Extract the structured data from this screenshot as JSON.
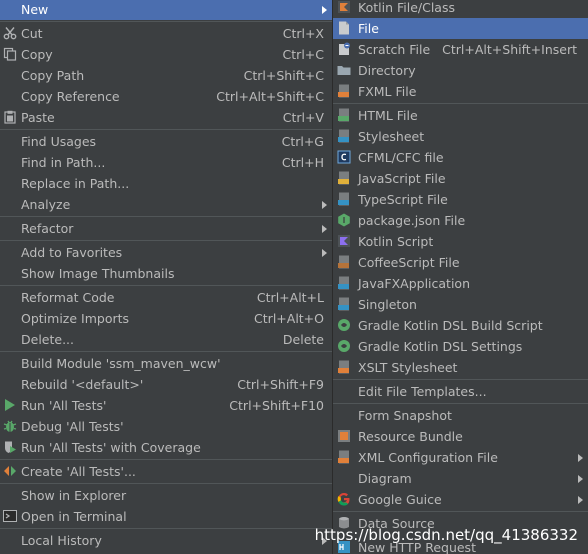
{
  "left_menu": {
    "new": {
      "label": "New"
    },
    "cut": {
      "label": "Cut",
      "shortcut": "Ctrl+X"
    },
    "copy": {
      "label": "Copy",
      "shortcut": "Ctrl+C"
    },
    "copy_path": {
      "label": "Copy Path",
      "shortcut": "Ctrl+Shift+C"
    },
    "copy_reference": {
      "label": "Copy Reference",
      "shortcut": "Ctrl+Alt+Shift+C"
    },
    "paste": {
      "label": "Paste",
      "shortcut": "Ctrl+V"
    },
    "find_usages": {
      "label": "Find Usages",
      "shortcut": "Ctrl+G"
    },
    "find_in_path": {
      "label": "Find in Path...",
      "shortcut": "Ctrl+H"
    },
    "replace_in_path": {
      "label": "Replace in Path..."
    },
    "analyze": {
      "label": "Analyze"
    },
    "refactor": {
      "label": "Refactor"
    },
    "add_to_favorites": {
      "label": "Add to Favorites"
    },
    "show_image_thumbnails": {
      "label": "Show Image Thumbnails"
    },
    "reformat_code": {
      "label": "Reformat Code",
      "shortcut": "Ctrl+Alt+L"
    },
    "optimize_imports": {
      "label": "Optimize Imports",
      "shortcut": "Ctrl+Alt+O"
    },
    "delete": {
      "label": "Delete...",
      "shortcut": "Delete"
    },
    "build_module": {
      "label": "Build Module 'ssm_maven_wcw'"
    },
    "rebuild": {
      "label": "Rebuild '<default>'",
      "shortcut": "Ctrl+Shift+F9"
    },
    "run_all_tests": {
      "label": "Run 'All Tests'",
      "shortcut": "Ctrl+Shift+F10"
    },
    "debug_all_tests": {
      "label": "Debug 'All Tests'"
    },
    "run_with_coverage": {
      "label": "Run 'All Tests' with Coverage"
    },
    "create_all_tests": {
      "label": "Create 'All Tests'..."
    },
    "show_in_explorer": {
      "label": "Show in Explorer"
    },
    "open_in_terminal": {
      "label": "Open in Terminal"
    },
    "local_history": {
      "label": "Local History"
    }
  },
  "right_menu": {
    "kotlin_file_class": {
      "label": "Kotlin File/Class"
    },
    "file": {
      "label": "File"
    },
    "scratch_file": {
      "label": "Scratch File",
      "shortcut": "Ctrl+Alt+Shift+Insert"
    },
    "directory": {
      "label": "Directory"
    },
    "fxml_file": {
      "label": "FXML File"
    },
    "html_file": {
      "label": "HTML File"
    },
    "stylesheet": {
      "label": "Stylesheet"
    },
    "cfml_cfc_file": {
      "label": "CFML/CFC file"
    },
    "javascript_file": {
      "label": "JavaScript File"
    },
    "typescript_file": {
      "label": "TypeScript File"
    },
    "package_json_file": {
      "label": "package.json File"
    },
    "kotlin_script": {
      "label": "Kotlin Script"
    },
    "coffeescript_file": {
      "label": "CoffeeScript File"
    },
    "javafx_application": {
      "label": "JavaFXApplication"
    },
    "singleton": {
      "label": "Singleton"
    },
    "gradle_kotlin_dsl_build_script": {
      "label": "Gradle Kotlin DSL Build Script"
    },
    "gradle_kotlin_dsl_settings": {
      "label": "Gradle Kotlin DSL Settings"
    },
    "xslt_stylesheet": {
      "label": "XSLT Stylesheet"
    },
    "edit_file_templates": {
      "label": "Edit File Templates..."
    },
    "form_snapshot": {
      "label": "Form Snapshot"
    },
    "resource_bundle": {
      "label": "Resource Bundle"
    },
    "xml_configuration_file": {
      "label": "XML Configuration File"
    },
    "diagram": {
      "label": "Diagram"
    },
    "google_guice": {
      "label": "Google Guice"
    },
    "data_source": {
      "label": "Data Source"
    },
    "new_http_request": {
      "label": "New HTTP Request"
    }
  },
  "watermark": "https://blog.csdn.net/qq_41386332",
  "colors": {
    "menu_bg": "#3c3f41",
    "selected_bg": "#4b6eaf",
    "text": "#bbbbbb",
    "separator": "#515658"
  }
}
